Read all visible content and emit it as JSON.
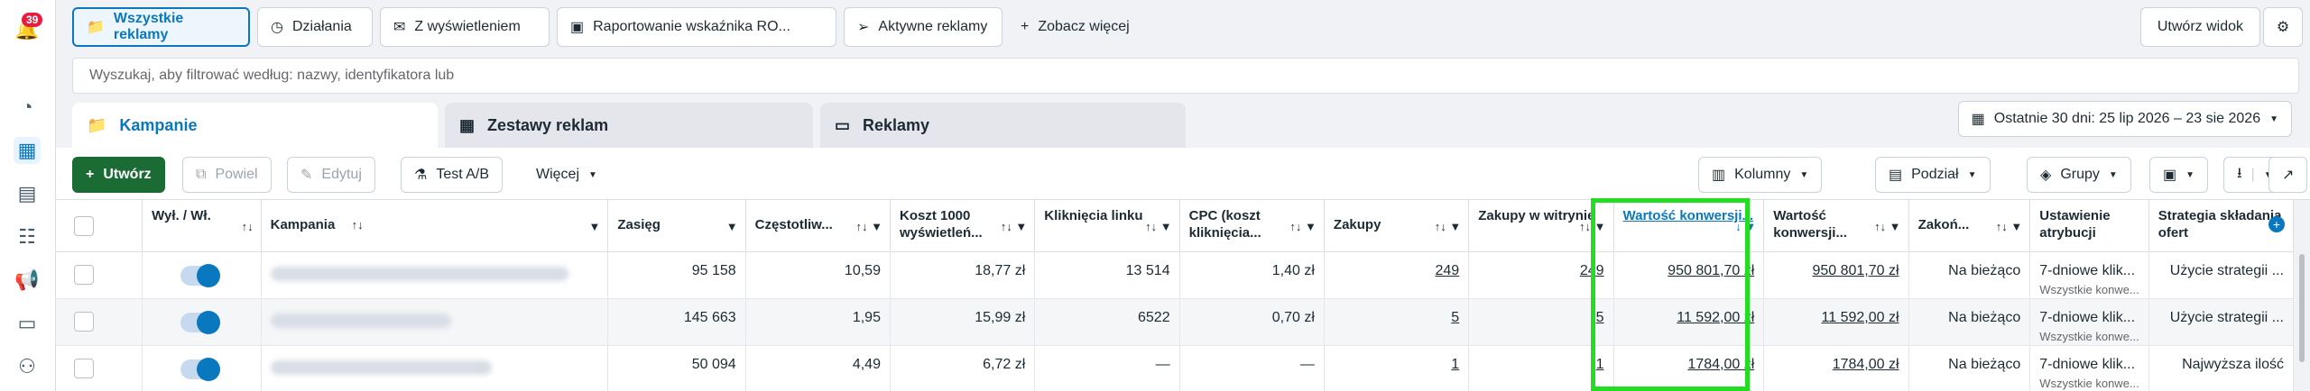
{
  "notifications_count": "39",
  "view_tabs": [
    {
      "label": "Wszystkie reklamy",
      "icon": "folder-icon"
    },
    {
      "label": "Działania",
      "icon": "activity-icon"
    },
    {
      "label": "Z wyświetleniem",
      "icon": "inbox-icon"
    },
    {
      "label": "Raportowanie wskaźnika RO...",
      "icon": "report-icon"
    },
    {
      "label": "Aktywne reklamy",
      "icon": "send-icon"
    }
  ],
  "see_more": "Zobacz więcej",
  "create_view": "Utwórz widok",
  "search_placeholder": "Wyszukaj, aby filtrować według: nazwy, identyfikatora lub",
  "level_tabs": {
    "campaigns": "Kampanie",
    "adsets": "Zestawy reklam",
    "ads": "Reklamy"
  },
  "date_range": "Ostatnie 30 dni: 25 lip 2026 – 23 sie 2026",
  "toolbar": {
    "create": "Utwórz",
    "duplicate": "Powiel",
    "edit": "Edytuj",
    "ab_test": "Test A/B",
    "more": "Więcej",
    "columns": "Kolumny",
    "breakdown": "Podział",
    "groups": "Grupy"
  },
  "columns": {
    "onoff": "Wył. / Wł.",
    "campaign": "Kampania",
    "reach": "Zasięg",
    "frequency": "Częstotliw...",
    "cpm": "Koszt 1000 wyświetleń...",
    "clicks": "Kliknięcia linku",
    "cpc": "CPC (koszt kliknięcia...",
    "purchases": "Zakupy",
    "web_purchases": "Zakupy w witrynie",
    "conv_value": "Wartość konwersji...",
    "conv_value2": "Wartość konwersji...",
    "ends": "Zakoń...",
    "attribution": "Ustawienie atrybucji",
    "bid_strategy": "Strategia składania ofert"
  },
  "rows": [
    {
      "reach": "95 158",
      "frequency": "10,59",
      "cpm": "18,77 zł",
      "clicks": "13 514",
      "cpc": "1,40 zł",
      "purchases": "249",
      "web_purchases": "249",
      "conv_value": "950 801,70 zł",
      "conv_value2": "950 801,70 zł",
      "ends": "Na bieżąco",
      "attribution": "7-dniowe klik...",
      "attribution_sub": "Wszystkie konwe...",
      "bid_strategy": "Użycie strategii ..."
    },
    {
      "reach": "145 663",
      "frequency": "1,95",
      "cpm": "15,99 zł",
      "clicks": "6522",
      "cpc": "0,70 zł",
      "purchases": "5",
      "web_purchases": "5",
      "conv_value": "11 592,00 zł",
      "conv_value2": "11 592,00 zł",
      "ends": "Na bieżąco",
      "attribution": "7-dniowe klik...",
      "attribution_sub": "Wszystkie konwe...",
      "bid_strategy": "Użycie strategii ..."
    },
    {
      "reach": "50 094",
      "frequency": "4,49",
      "cpm": "6,72 zł",
      "clicks": "—",
      "cpc": "—",
      "purchases": "1",
      "web_purchases": "1",
      "conv_value": "1784,00 zł",
      "conv_value2": "1784,00 zł",
      "ends": "Na bieżąco",
      "attribution": "7-dniowe klik...",
      "attribution_sub": "Wszystkie konwe...",
      "bid_strategy": "Najwyższa ilość"
    }
  ],
  "colors": {
    "accent": "#0a78be",
    "create_green": "#1a6b34",
    "highlight": "#22dd22"
  }
}
